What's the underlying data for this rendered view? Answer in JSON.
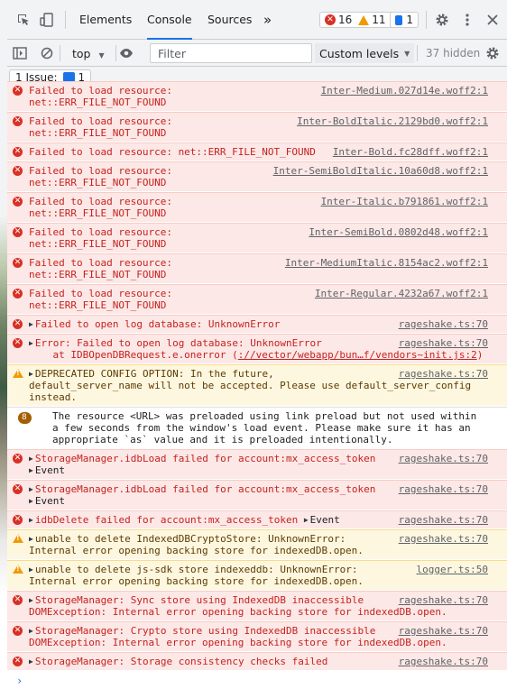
{
  "tabs": [
    {
      "label": "Elements"
    },
    {
      "label": "Console"
    },
    {
      "label": "Sources"
    }
  ],
  "more_tabs_label": "»",
  "counters": {
    "errors": "16",
    "warnings": "11",
    "info": "1"
  },
  "toolbar": {
    "context": "top",
    "filter_placeholder": "Filter",
    "levels": "Custom levels",
    "hidden": "37 hidden"
  },
  "issues": {
    "label": "1 Issue:",
    "count": "1"
  },
  "messages": [
    {
      "level": "error",
      "text": "Failed to load resource:\nnet::ERR_FILE_NOT_FOUND",
      "source": "Inter-Medium.027d14e.woff2:1"
    },
    {
      "level": "error",
      "text": "Failed to load resource:\nnet::ERR_FILE_NOT_FOUND",
      "source": "Inter-BoldItalic.2129bd0.woff2:1"
    },
    {
      "level": "error",
      "text": "Failed to load resource: net::ERR_FILE_NOT_FOUND",
      "source": "Inter-Bold.fc28dff.woff2:1"
    },
    {
      "level": "error",
      "text": "Failed to load resource:\nnet::ERR_FILE_NOT_FOUND",
      "source": "Inter-SemiBoldItalic.10a60d8.woff2:1"
    },
    {
      "level": "error",
      "text": "Failed to load resource:\nnet::ERR_FILE_NOT_FOUND",
      "source": "Inter-Italic.b791861.woff2:1"
    },
    {
      "level": "error",
      "text": "Failed to load resource:\nnet::ERR_FILE_NOT_FOUND",
      "source": "Inter-SemiBold.0802d48.woff2:1"
    },
    {
      "level": "error",
      "text": "Failed to load resource:\nnet::ERR_FILE_NOT_FOUND",
      "source": "Inter-MediumItalic.8154ac2.woff2:1"
    },
    {
      "level": "error",
      "text": "Failed to load resource:\nnet::ERR_FILE_NOT_FOUND",
      "source": "Inter-Regular.4232a67.woff2:1"
    },
    {
      "level": "error",
      "text": "Failed to open log database: UnknownError",
      "source": "rageshake.ts:70",
      "expandable": true
    },
    {
      "level": "error",
      "text": "Error: Failed to open log database: UnknownError\n    at IDBOpenDBRequest.e.onerror (",
      "link": "://vector/webapp/bun…f/vendors~init.js:2",
      "after": ")",
      "source": "rageshake.ts:70",
      "expandable": true
    },
    {
      "level": "warning",
      "text": "DEPRECATED CONFIG OPTION: In the future,\ndefault_server_name will not be accepted. Please use default_server_config\ninstead.",
      "source": "rageshake.ts:70",
      "expandable": true
    },
    {
      "level": "info",
      "text": "The resource <URL> was preloaded using link preload but not used within\na few seconds from the window's load event. Please make sure it has an\nappropriate `as` value and it is preloaded intentionally.",
      "badge": "8"
    },
    {
      "level": "error",
      "text": "StorageManager.idbLoad failed for account:mx_access_token",
      "child": "Event",
      "source": "rageshake.ts:70",
      "expandable": true
    },
    {
      "level": "error",
      "text": "StorageManager.idbLoad failed for account:mx_access_token",
      "child": "Event",
      "source": "rageshake.ts:70",
      "expandable": true
    },
    {
      "level": "error",
      "text": "idbDelete failed for account:mx_access_token ",
      "inline_child": "Event",
      "source": "rageshake.ts:70",
      "expandable": true
    },
    {
      "level": "warning",
      "text": "unable to delete IndexedDBCryptoStore: UnknownError:\nInternal error opening backing store for indexedDB.open.",
      "source": "rageshake.ts:70",
      "expandable": true
    },
    {
      "level": "warning",
      "text": "unable to delete js-sdk store indexeddb: UnknownError:\nInternal error opening backing store for indexedDB.open.",
      "source": "logger.ts:50",
      "expandable": true
    },
    {
      "level": "error",
      "text": "StorageManager: Sync store using IndexedDB inaccessible\nDOMException: Internal error opening backing store for indexedDB.open.",
      "source": "rageshake.ts:70",
      "expandable": true
    },
    {
      "level": "error",
      "text": "StorageManager: Crypto store using IndexedDB inaccessible\nDOMException: Internal error opening backing store for indexedDB.open.",
      "source": "rageshake.ts:70",
      "expandable": true
    },
    {
      "level": "error",
      "text": "StorageManager: Storage consistency checks failed",
      "source": "rageshake.ts:70",
      "expandable": true
    }
  ],
  "prompt": "›"
}
